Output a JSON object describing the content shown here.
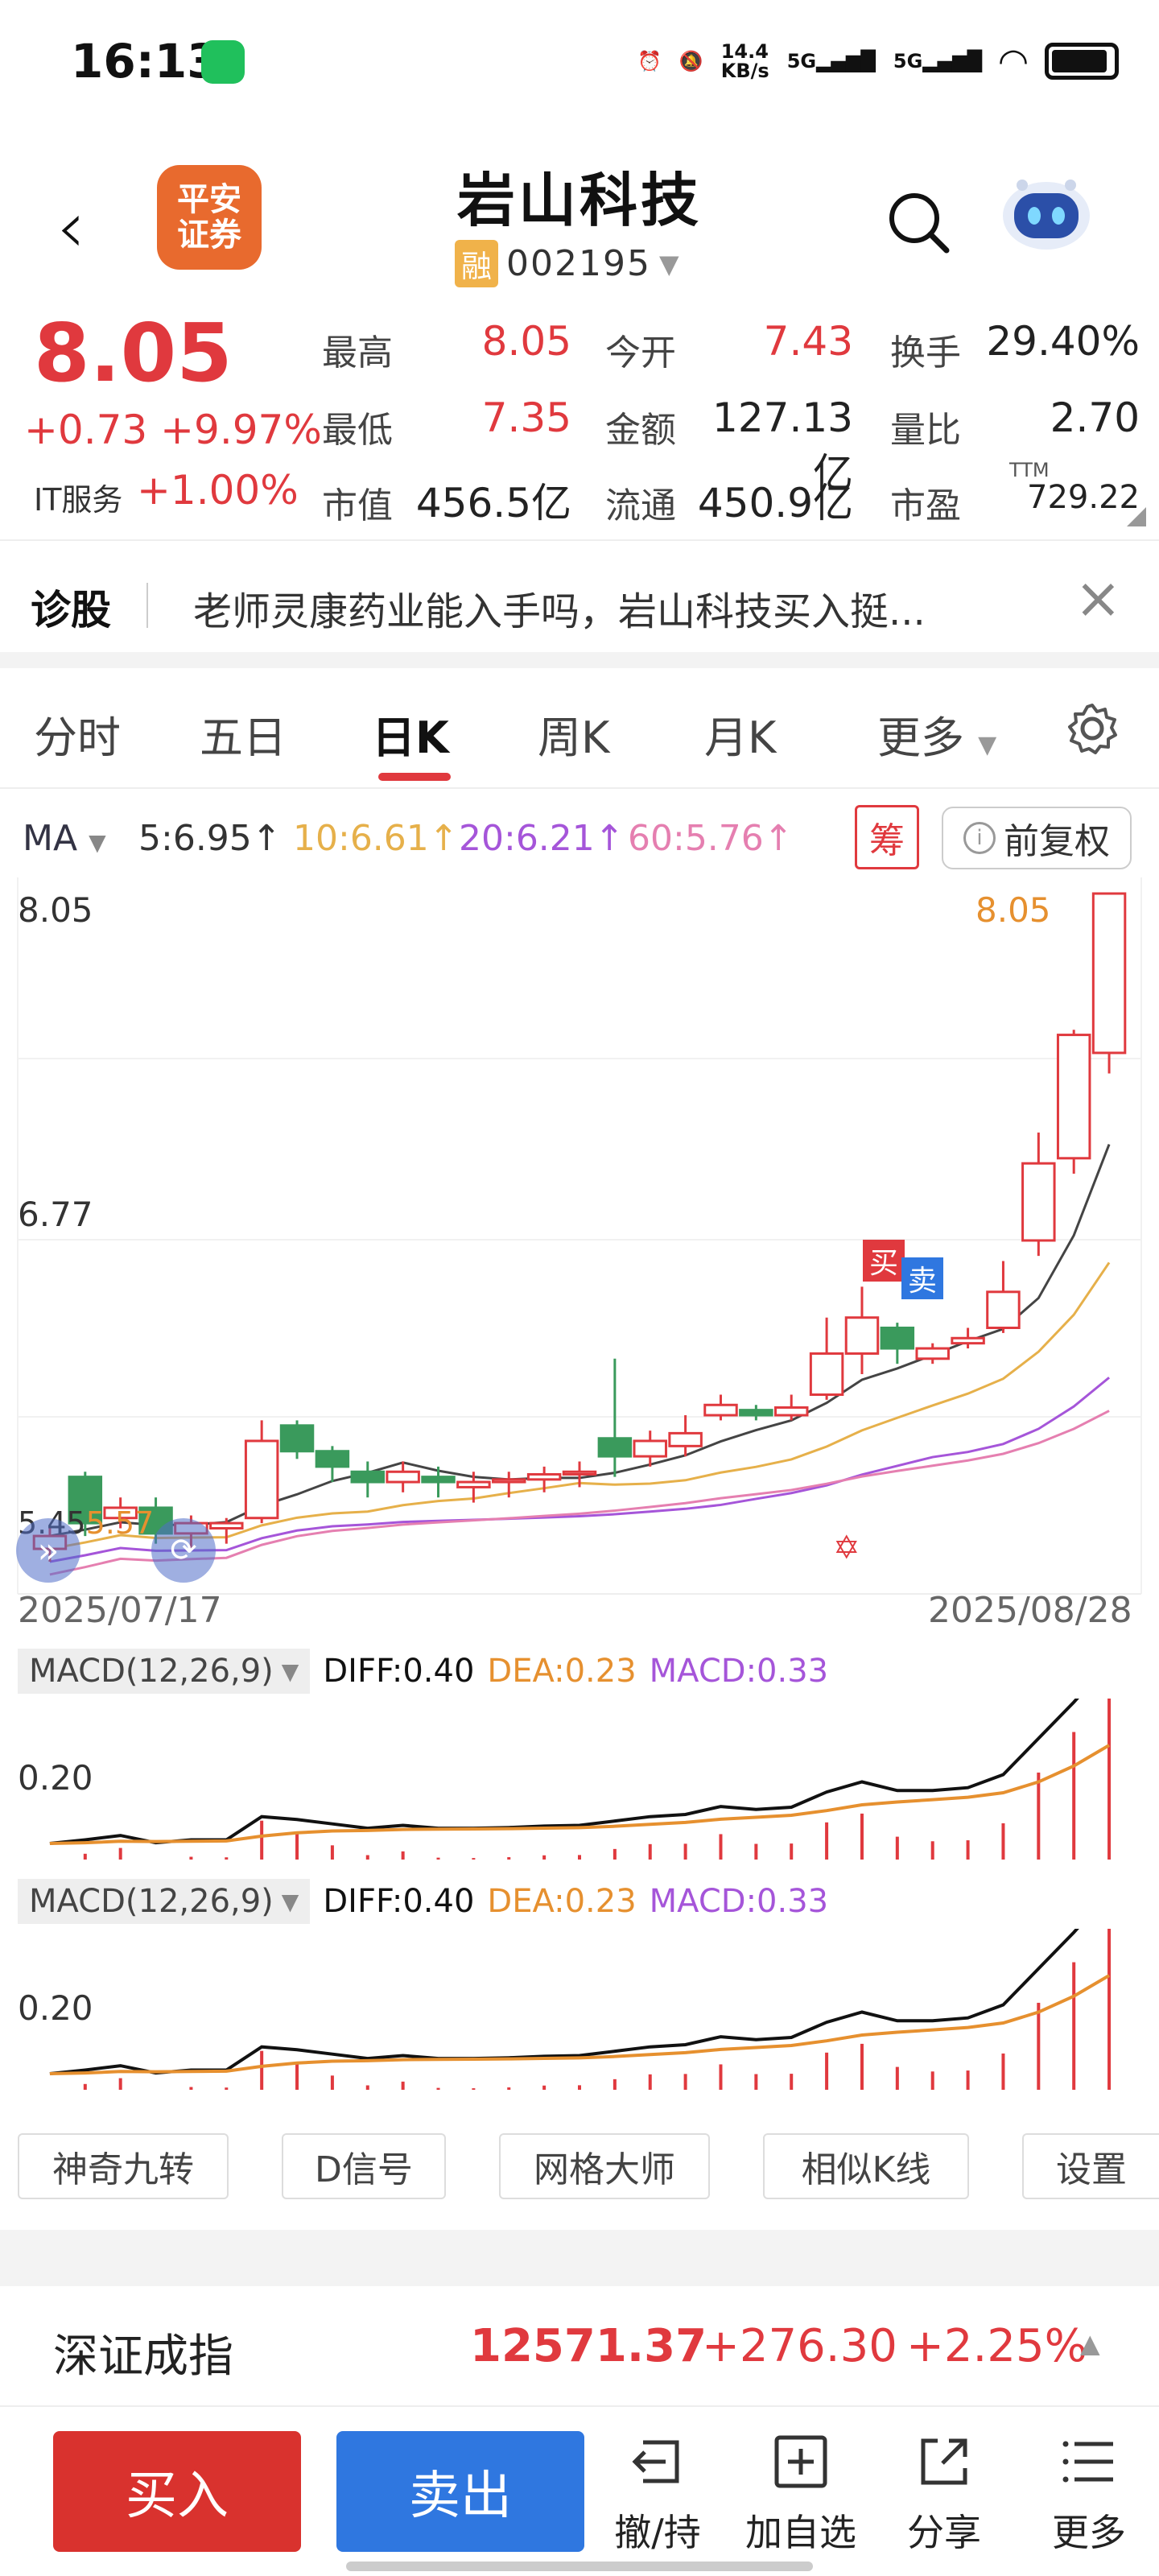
{
  "status_bar": {
    "time": "16:13",
    "net_speed_value": "14.4",
    "net_speed_unit": "KB/s",
    "sig1": "5G",
    "sig2": "5G"
  },
  "header": {
    "stock_name": "岩山科技",
    "margin_badge": "融",
    "code": "002195",
    "logo_text": "平安\n证券"
  },
  "quote": {
    "price": "8.05",
    "change": "+0.73",
    "change_pct": "+9.97%",
    "sector": "IT服务",
    "sector_pct": "+1.00%",
    "high_label": "最高",
    "high": "8.05",
    "open_label": "今开",
    "open": "7.43",
    "turnover_label": "换手",
    "turnover": "29.40%",
    "low_label": "最低",
    "low": "7.35",
    "amount_label": "金额",
    "amount": "127.13亿",
    "vol_ratio_label": "量比",
    "vol_ratio": "2.70",
    "mktcap_label": "市值",
    "mktcap": "456.5亿",
    "float_label": "流通",
    "float": "450.9亿",
    "pe_label": "市盈",
    "pe_sup": "TTM",
    "pe": "729.22"
  },
  "diagnosis": {
    "label": "诊股",
    "text": "老师灵康药业能入手吗，岩山科技买入挺..."
  },
  "tabs": [
    "分时",
    "五日",
    "日K",
    "周K",
    "月K",
    "更多"
  ],
  "ma": {
    "label": "MA",
    "ma5": "5:6.95↑",
    "ma10": "10:6.61↑",
    "ma20": "20:6.21↑",
    "ma60": "60:5.76↑",
    "chip": "筹",
    "adjust": "前复权"
  },
  "chart": {
    "y_top": "8.05",
    "y_mid": "6.77",
    "high_marker": "8.05",
    "buy_tag": "买",
    "sell_tag": "卖",
    "date_start": "2025/07/17",
    "date_end": "2025/08/28",
    "low_left_label": "5.45",
    "low_left_label2": "5.57"
  },
  "chart_data": {
    "type": "candlestick",
    "title": "",
    "x": [
      "2025/07/17",
      "2025/08/28"
    ],
    "ylim": [
      5.45,
      8.05
    ],
    "candles": [
      {
        "o": 5.5,
        "c": 5.55,
        "h": 5.58,
        "l": 5.45,
        "dir": "up"
      },
      {
        "o": 5.78,
        "c": 5.6,
        "h": 5.8,
        "l": 5.55,
        "dir": "down"
      },
      {
        "o": 5.62,
        "c": 5.66,
        "h": 5.7,
        "l": 5.58,
        "dir": "up"
      },
      {
        "o": 5.66,
        "c": 5.56,
        "h": 5.7,
        "l": 5.52,
        "dir": "down"
      },
      {
        "o": 5.56,
        "c": 5.6,
        "h": 5.63,
        "l": 5.5,
        "dir": "up"
      },
      {
        "o": 5.58,
        "c": 5.6,
        "h": 5.62,
        "l": 5.52,
        "dir": "up"
      },
      {
        "o": 5.62,
        "c": 5.92,
        "h": 6.0,
        "l": 5.6,
        "dir": "up"
      },
      {
        "o": 5.98,
        "c": 5.88,
        "h": 6.0,
        "l": 5.85,
        "dir": "down"
      },
      {
        "o": 5.88,
        "c": 5.82,
        "h": 5.9,
        "l": 5.76,
        "dir": "down"
      },
      {
        "o": 5.8,
        "c": 5.76,
        "h": 5.84,
        "l": 5.7,
        "dir": "down"
      },
      {
        "o": 5.76,
        "c": 5.8,
        "h": 5.84,
        "l": 5.72,
        "dir": "up"
      },
      {
        "o": 5.78,
        "c": 5.76,
        "h": 5.82,
        "l": 5.7,
        "dir": "down"
      },
      {
        "o": 5.74,
        "c": 5.76,
        "h": 5.8,
        "l": 5.68,
        "dir": "up"
      },
      {
        "o": 5.76,
        "c": 5.77,
        "h": 5.8,
        "l": 5.7,
        "dir": "up"
      },
      {
        "o": 5.77,
        "c": 5.79,
        "h": 5.82,
        "l": 5.72,
        "dir": "up"
      },
      {
        "o": 5.79,
        "c": 5.8,
        "h": 5.84,
        "l": 5.74,
        "dir": "up"
      },
      {
        "o": 5.93,
        "c": 5.86,
        "h": 6.24,
        "l": 5.78,
        "dir": "down"
      },
      {
        "o": 5.86,
        "c": 5.92,
        "h": 5.96,
        "l": 5.82,
        "dir": "up"
      },
      {
        "o": 5.9,
        "c": 5.95,
        "h": 6.02,
        "l": 5.86,
        "dir": "up"
      },
      {
        "o": 6.02,
        "c": 6.06,
        "h": 6.1,
        "l": 6.0,
        "dir": "up"
      },
      {
        "o": 6.04,
        "c": 6.02,
        "h": 6.06,
        "l": 6.0,
        "dir": "down"
      },
      {
        "o": 6.02,
        "c": 6.05,
        "h": 6.1,
        "l": 6.0,
        "dir": "up"
      },
      {
        "o": 6.1,
        "c": 6.26,
        "h": 6.4,
        "l": 6.08,
        "dir": "up"
      },
      {
        "o": 6.26,
        "c": 6.4,
        "h": 6.52,
        "l": 6.18,
        "dir": "up"
      },
      {
        "o": 6.36,
        "c": 6.28,
        "h": 6.38,
        "l": 6.22,
        "dir": "down"
      },
      {
        "o": 6.24,
        "c": 6.28,
        "h": 6.3,
        "l": 6.22,
        "dir": "up"
      },
      {
        "o": 6.3,
        "c": 6.32,
        "h": 6.36,
        "l": 6.28,
        "dir": "up"
      },
      {
        "o": 6.36,
        "c": 6.5,
        "h": 6.62,
        "l": 6.34,
        "dir": "up"
      },
      {
        "o": 6.7,
        "c": 7.0,
        "h": 7.12,
        "l": 6.64,
        "dir": "up"
      },
      {
        "o": 7.02,
        "c": 7.5,
        "h": 7.52,
        "l": 6.96,
        "dir": "up"
      },
      {
        "o": 7.43,
        "c": 8.05,
        "h": 8.05,
        "l": 7.35,
        "dir": "up"
      }
    ],
    "series": [
      {
        "name": "MA5",
        "color": "#444444"
      },
      {
        "name": "MA10",
        "color": "#e6b04a"
      },
      {
        "name": "MA20",
        "color": "#a555d9"
      },
      {
        "name": "MA60",
        "color": "#e57fb0"
      }
    ]
  },
  "macd": {
    "name": "MACD(12,26,9)",
    "diff": "DIFF:0.40",
    "dea": "DEA:0.23",
    "macd": "MACD:0.33",
    "y_label": "0.20"
  },
  "tools": [
    "神奇九转",
    "D信号",
    "网格大师",
    "相似K线",
    "设置"
  ],
  "index": {
    "name": "深证成指",
    "value": "12571.37",
    "change": "+276.30",
    "pct": "+2.25%"
  },
  "bottom": {
    "buy": "买入",
    "sell": "卖出",
    "withdraw": "撤/持",
    "add": "加自选",
    "share": "分享",
    "more": "更多"
  }
}
